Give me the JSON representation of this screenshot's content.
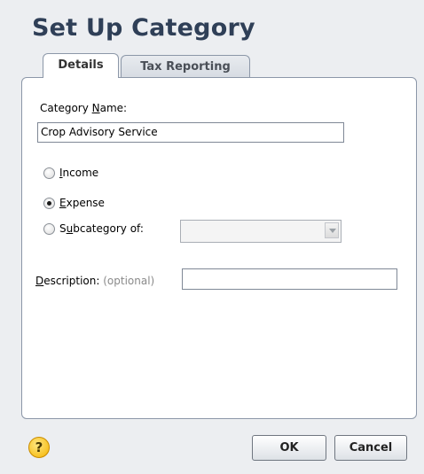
{
  "dialog": {
    "title": "Set Up Category"
  },
  "tabs": [
    {
      "label": "Details",
      "active": true
    },
    {
      "label": "Tax Reporting",
      "active": false
    }
  ],
  "form": {
    "category_name": {
      "label_pre": "Category ",
      "label_access": "N",
      "label_post": "ame:",
      "value": "Crop Advisory Service"
    },
    "type_options": [
      {
        "access": "I",
        "rest": "ncome",
        "checked": false
      },
      {
        "access": "E",
        "rest": "xpense",
        "checked": true
      },
      {
        "pre": "S",
        "access": "u",
        "rest": "bcategory of:",
        "checked": false
      }
    ],
    "subcategory_value": "",
    "description": {
      "label_access": "D",
      "label_rest": "escription:",
      "optional": "(optional)",
      "value": ""
    }
  },
  "footer": {
    "help_icon": "help-icon",
    "help_glyph": "?",
    "ok_label": "OK",
    "cancel_label": "Cancel"
  },
  "colors": {
    "title": "#2f3f57",
    "background": "#eceef1",
    "panel": "#ffffff",
    "help_icon": "#f4b400"
  }
}
